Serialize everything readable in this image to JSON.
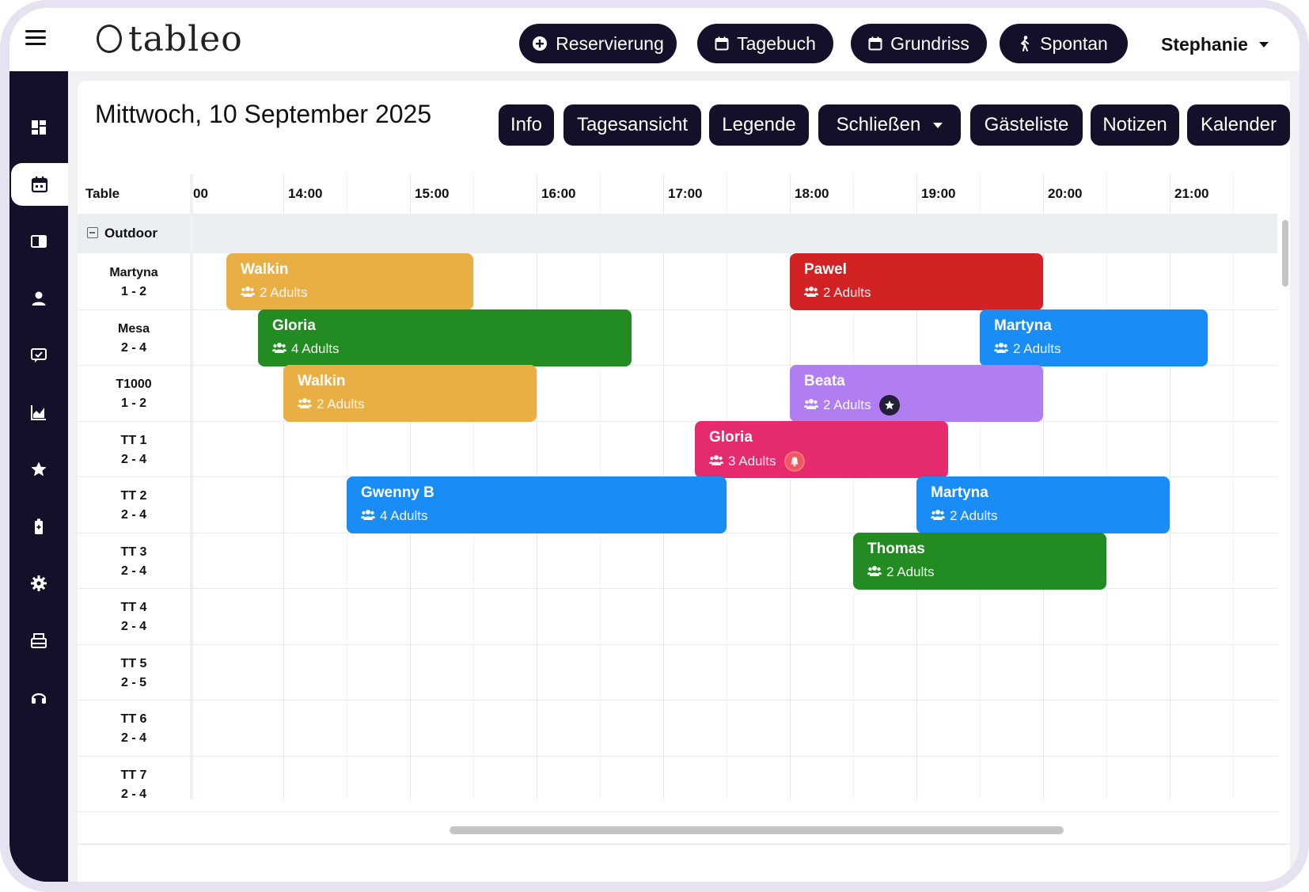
{
  "app": {
    "logo_text": "tableo"
  },
  "topbar": {
    "buttons": [
      {
        "label": "Reservierung",
        "icon": "plus-circle-icon"
      },
      {
        "label": "Tagebuch",
        "icon": "calendar-icon"
      },
      {
        "label": "Grundriss",
        "icon": "calendar-icon"
      },
      {
        "label": "Spontan",
        "icon": "walking-icon"
      }
    ],
    "user": "Stephanie"
  },
  "header": {
    "date": "Mittwoch, 10 September 2025",
    "buttons": [
      "Info",
      "Tagesansicht",
      "Legende",
      "Schließen",
      "Gästeliste",
      "Notizen",
      "Kalender"
    ]
  },
  "timeline": {
    "table_header": "Table",
    "hours": [
      "00",
      "14:00",
      "15:00",
      "16:00",
      "17:00",
      "18:00",
      "19:00",
      "20:00",
      "21:00"
    ],
    "section": "Outdoor",
    "tables": [
      {
        "name": "Martyna",
        "capacity": "1 - 2"
      },
      {
        "name": "Mesa",
        "capacity": "2 - 4"
      },
      {
        "name": "T1000",
        "capacity": "1 - 2"
      },
      {
        "name": "TT 1",
        "capacity": "2 - 4"
      },
      {
        "name": "TT 2",
        "capacity": "2 - 4"
      },
      {
        "name": "TT 3",
        "capacity": "2 - 4"
      },
      {
        "name": "TT 4",
        "capacity": "2 - 4"
      },
      {
        "name": "TT 5",
        "capacity": "2 - 5"
      },
      {
        "name": "TT 6",
        "capacity": "2 - 4"
      },
      {
        "name": "TT 7",
        "capacity": "2 - 4"
      }
    ],
    "reservations": [
      {
        "guest": "Walkin",
        "pax": "2 Adults",
        "table": 0,
        "start": 13.55,
        "end": 15.5,
        "color": "#e9ae44"
      },
      {
        "guest": "Pawel",
        "pax": "2 Adults",
        "table": 0,
        "start": 18.0,
        "end": 20.0,
        "color": "#d22223"
      },
      {
        "guest": "Gloria",
        "pax": "4 Adults",
        "table": 1,
        "start": 13.8,
        "end": 16.75,
        "color": "#228b22"
      },
      {
        "guest": "Martyna",
        "pax": "2 Adults",
        "table": 1,
        "start": 19.5,
        "end": 21.3,
        "color": "#1a8cf5"
      },
      {
        "guest": "Walkin",
        "pax": "2 Adults",
        "table": 2,
        "start": 14.0,
        "end": 16.0,
        "color": "#e9ae44"
      },
      {
        "guest": "Beata",
        "pax": "2 Adults",
        "table": 2,
        "start": 18.0,
        "end": 20.0,
        "color": "#b07ef0",
        "badge": "star-icon"
      },
      {
        "guest": "Gloria",
        "pax": "3 Adults",
        "table": 3,
        "start": 17.25,
        "end": 19.25,
        "color": "#e62a6e",
        "badge": "bell-icon"
      },
      {
        "guest": "Gwenny B",
        "pax": "4 Adults",
        "table": 4,
        "start": 14.5,
        "end": 17.5,
        "color": "#1a8cf5"
      },
      {
        "guest": "Martyna",
        "pax": "2 Adults",
        "table": 4,
        "start": 19.0,
        "end": 21.0,
        "color": "#1a8cf5"
      },
      {
        "guest": "Thomas",
        "pax": "2 Adults",
        "table": 5,
        "start": 18.5,
        "end": 20.5,
        "color": "#228b22"
      }
    ]
  },
  "colors": {
    "dark": "#131129",
    "frame": "#e6e2f2"
  }
}
